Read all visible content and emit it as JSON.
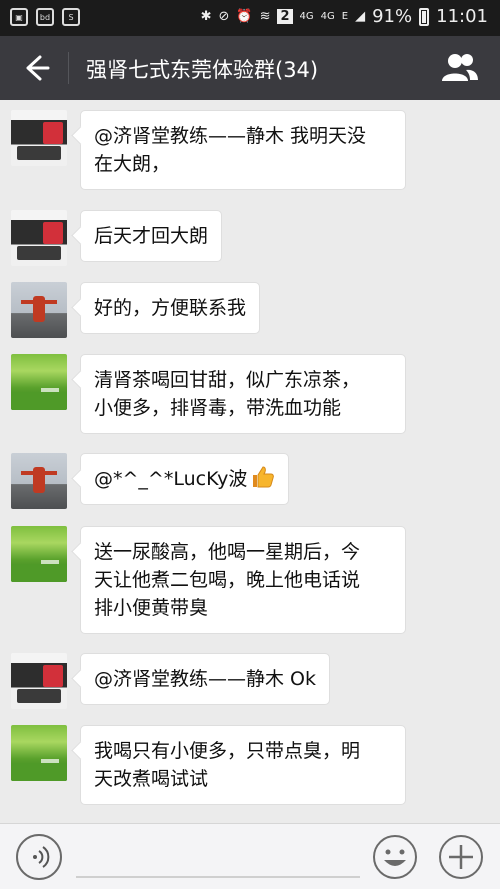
{
  "status_bar": {
    "network_4g_a": "4G",
    "network_4g_b": "4G",
    "network_e": "E",
    "sim_slot": "2",
    "battery_percent": "91%",
    "time": "11:01",
    "icons": [
      "image-icon",
      "baidu-icon",
      "store-icon",
      "bluetooth-icon",
      "mute-icon",
      "alarm-icon",
      "wifi-icon",
      "signal-icon",
      "battery-icon"
    ]
  },
  "header": {
    "title": "强肾七式东莞体验群(34)"
  },
  "messages": [
    {
      "avatar": "clothes",
      "lines": [
        "@济肾堂教练——静木 我明天没",
        "在大朗，"
      ]
    },
    {
      "avatar": "clothes",
      "lines": [
        "后天才回大朗"
      ]
    },
    {
      "avatar": "man",
      "lines": [
        "好的，方便联系我"
      ]
    },
    {
      "avatar": "grass",
      "lines": [
        "清肾茶喝回甘甜，似广东凉茶，",
        "小便多，排肾毒，带洗血功能"
      ]
    },
    {
      "avatar": "man",
      "lines": [
        "@*^_^*LucKy波"
      ],
      "emoji": "thumbs-up"
    },
    {
      "avatar": "grass",
      "lines": [
        "送一尿酸高，他喝一星期后，今",
        "天让他煮二包喝，晚上他电话说",
        "排小便黄带臭"
      ]
    },
    {
      "avatar": "clothes",
      "lines": [
        "@济肾堂教练——静木 Ok"
      ]
    },
    {
      "avatar": "grass",
      "lines": [
        "我喝只有小便多，只带点臭，明",
        "天改煮喝试试"
      ]
    }
  ]
}
